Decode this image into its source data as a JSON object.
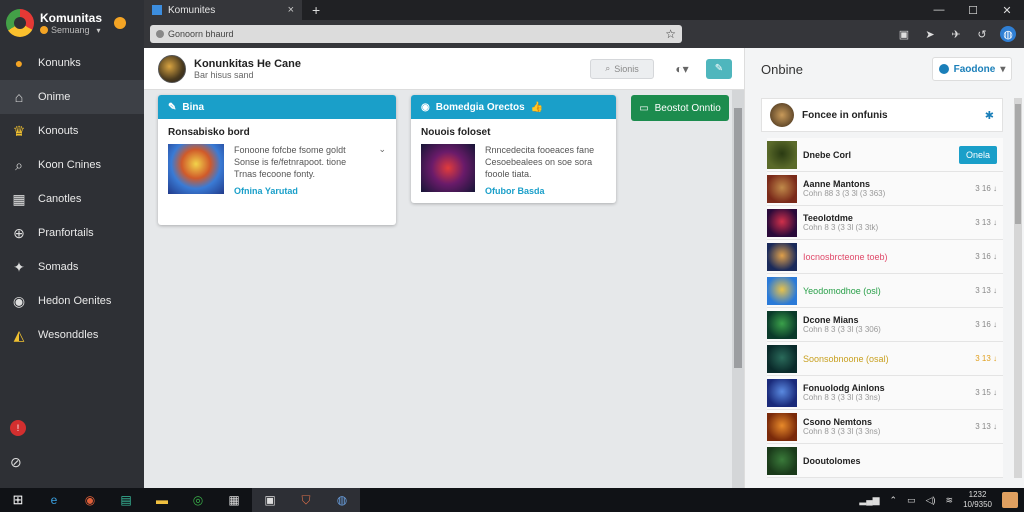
{
  "sidebar": {
    "title": "Komunitas",
    "subtitle": "Semuang",
    "items": [
      {
        "label": "Konunks",
        "icon": "orange-circle-icon"
      },
      {
        "label": "Onime",
        "icon": "home-icon"
      },
      {
        "label": "Konouts",
        "icon": "trophy-icon"
      },
      {
        "label": "Koon Cnines",
        "icon": "search-icon"
      },
      {
        "label": "Canotles",
        "icon": "grid-icon"
      },
      {
        "label": "Pranfortails",
        "icon": "gamepad-icon"
      },
      {
        "label": "Somads",
        "icon": "wrench-icon"
      },
      {
        "label": "Hedon Oenites",
        "icon": "person-circle-icon"
      },
      {
        "label": "Wesonddles",
        "icon": "flag-icon"
      }
    ]
  },
  "browser": {
    "tab_title": "Komunites",
    "address": "Gonoorn bhaurd",
    "tab_close": "×",
    "new_tab": "+"
  },
  "app": {
    "header_title": "Konunkitas He Cane",
    "header_sub": "Bar hisus sand",
    "search_placeholder": "Sionis"
  },
  "cards": [
    {
      "header": "Bina",
      "title": "Ronsabisko bord",
      "text": [
        "Fonoone fofcbe fsome goldt",
        "Sonse is fe/fetnrapoot. tione",
        "Trnas fecoone fonty."
      ],
      "link": "Ofnina Yarutad"
    },
    {
      "header": "Bomedgia Orectos",
      "title": "Nouois foloset",
      "text": [
        "Rnncedecita fooeaces fane",
        "Cesoebealees on soe sora",
        "fooole tiata."
      ],
      "link": "Ofubor Basda"
    }
  ],
  "green_button": "Beostot Onntio",
  "right_panel": {
    "title": "Onbine",
    "button": "Faodone",
    "profile_name": "Foncee in onfunis",
    "list": [
      {
        "title": "Dnebe Corl",
        "sub": "",
        "meta": "",
        "button": "Onela",
        "colors": [
          "#5a6a2a",
          "#2a3a12"
        ]
      },
      {
        "title": "Aanne Mantons",
        "sub": "Cohn 88 3 (3 3l (3 363)",
        "meta": "3 16 ↓",
        "colors": [
          "#7a2a1a",
          "#c08a4a"
        ]
      },
      {
        "title": "Teeolotdme",
        "sub": "Cohn 8 3 (3 3l (3 3tk)",
        "meta": "3 13 ↓",
        "colors": [
          "#2a0a3a",
          "#d0304a"
        ]
      },
      {
        "title": "Iocnosbrcteone toeb)",
        "sub": "",
        "meta": "3 16 ↓",
        "colors": [
          "#1a2a5a",
          "#e0a04a"
        ],
        "title_color": "#e04a6a"
      },
      {
        "title": "Yeodomodhoe (osl)",
        "sub": "",
        "meta": "3 13 ↓",
        "colors": [
          "#2a7ad8",
          "#e8c24a"
        ],
        "title_color": "#2aa04a"
      },
      {
        "title": "Dcone Mians",
        "sub": "Cohn 8 3 (3 3l (3 306)",
        "meta": "3 16 ↓",
        "colors": [
          "#0a3a2a",
          "#3aa04a"
        ]
      },
      {
        "title": "Soonsobnoone (osal)",
        "sub": "",
        "meta": "3 13 ↓",
        "colors": [
          "#0a2a2a",
          "#2a6a5a"
        ],
        "title_color": "#c8a020",
        "meta_color": "#e0a020"
      },
      {
        "title": "Fonuolodg Ainlons",
        "sub": "Cohn 8 3 (3 3l (3 3ns)",
        "meta": "3 15 ↓",
        "colors": [
          "#1a2a7a",
          "#5a8ae0"
        ]
      },
      {
        "title": "Csono Nemtons",
        "sub": "Cohn 8 3 (3 3l (3 3ns)",
        "meta": "3 13 ↓",
        "colors": [
          "#7a2a0a",
          "#e88a2a"
        ]
      },
      {
        "title": "Dooutolomes",
        "sub": "",
        "meta": "",
        "colors": [
          "#1a3a1a",
          "#3a7a3a"
        ]
      }
    ]
  },
  "taskbar": {
    "clock_time": "1232",
    "clock_date": "10/9350"
  }
}
